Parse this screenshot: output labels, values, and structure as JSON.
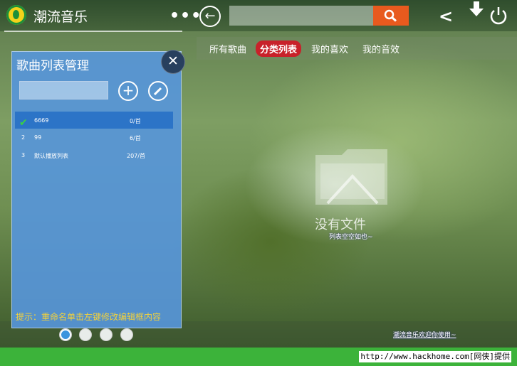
{
  "app": {
    "title": "潮流音乐"
  },
  "header": {
    "menu_icon": "more-icon",
    "search_placeholder": ""
  },
  "tabs": [
    {
      "label": "所有歌曲",
      "active": false
    },
    {
      "label": "分类列表",
      "active": true
    },
    {
      "label": "我的喜欢",
      "active": false
    },
    {
      "label": "我的音效",
      "active": false
    }
  ],
  "empty_state": {
    "title": "没有文件",
    "subtitle": "列表空空如也~"
  },
  "status_link": "潮流音乐欢迎你使用~",
  "panel": {
    "title": "歌曲列表管理",
    "input_value": "",
    "rows": [
      {
        "index": "",
        "name": "6669",
        "count": "0/首",
        "selected": true
      },
      {
        "index": "2",
        "name": "99",
        "count": "6/首",
        "selected": false
      },
      {
        "index": "3",
        "name": "默认播放列表",
        "count": "207/首",
        "selected": false
      }
    ],
    "hint": "提示：重命名单击左键修改编辑框内容"
  },
  "pager": {
    "count": 4,
    "active_index": 0
  },
  "footer": {
    "text": "http://www.hackhome.com[网侠]提供"
  },
  "colors": {
    "accent": "#c8212a",
    "panel": "#5696dc",
    "footer": "#3cb33a",
    "search_btn": "#e85a1e"
  }
}
